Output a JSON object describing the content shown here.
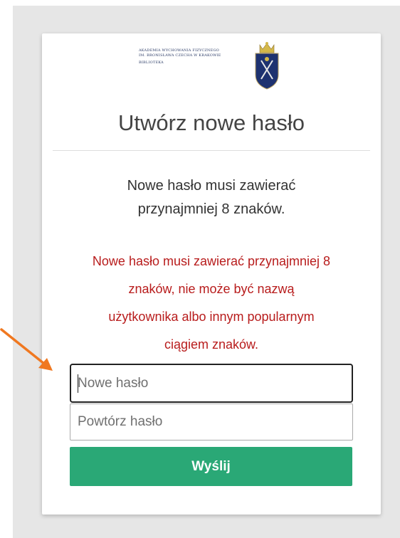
{
  "logo": {
    "line1": "AKADEMIA WYCHOWANIA FIZYCZNEGO",
    "line2": "IM. BRONISŁAWA CZECHA W KRAKOWIE",
    "line3": "BIBLIOTEKA",
    "icon": "academy-crest-icon"
  },
  "page": {
    "title": "Utwórz nowe hasło",
    "info_line1": "Nowe hasło musi zawierać",
    "info_line2": "przynajmniej 8 znaków.",
    "error_line1": "Nowe hasło musi zawierać przynajmniej 8",
    "error_line2": "znaków, nie może być nazwą",
    "error_line3": "użytkownika albo innym popularnym",
    "error_line4": "ciągiem znaków."
  },
  "form": {
    "new_password": {
      "value": "",
      "placeholder": "Nowe hasło"
    },
    "repeat_password": {
      "value": "",
      "placeholder": "Powtórz hasło"
    },
    "submit_label": "Wyślij"
  },
  "colors": {
    "accent": "#2aa876",
    "error": "#b81c1c",
    "annotation_arrow": "#f07820"
  }
}
